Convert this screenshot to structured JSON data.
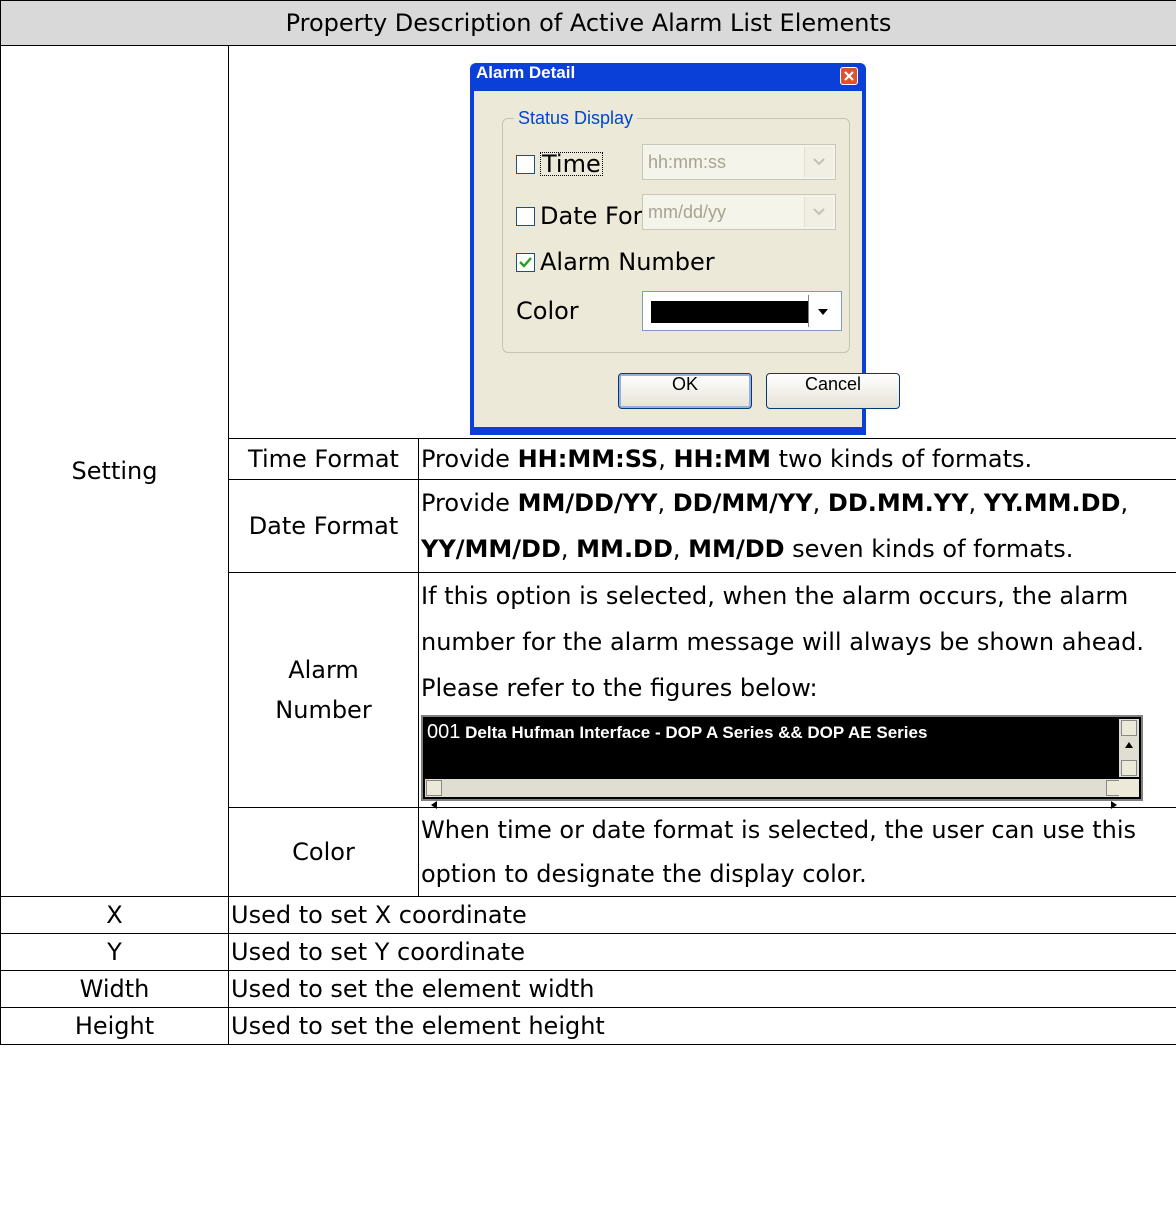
{
  "table": {
    "header": "Property Description of Active Alarm List Elements",
    "setting_label": "Setting",
    "rows": [
      {
        "name": "Time Format",
        "desc_parts": [
          "Provide ",
          "HH:MM:SS",
          ", ",
          "HH:MM",
          " two kinds of formats."
        ]
      },
      {
        "name": "Date Format",
        "desc_parts": [
          "Provide ",
          "MM/DD/YY",
          ", ",
          "DD/MM/YY",
          ", ",
          "DD.MM.YY",
          ", ",
          "YY.MM.DD",
          ", ",
          "YY/MM/DD",
          ", ",
          "MM.DD",
          ", ",
          "MM/DD",
          " seven kinds of formats."
        ]
      },
      {
        "name": "Alarm Number",
        "desc": "If this option is selected, when the alarm occurs, the alarm number for the alarm message will always be shown ahead. Please refer to the figures below:"
      },
      {
        "name": "Color",
        "desc": "When time or date format is selected, the user can use this option to designate the display color."
      }
    ],
    "simple_rows": [
      {
        "name": "X",
        "desc": "Used to set X coordinate"
      },
      {
        "name": "Y",
        "desc": "Used to set Y coordinate"
      },
      {
        "name": "Width",
        "desc": "Used to set the element width"
      },
      {
        "name": "Height",
        "desc": "Used to set the element height"
      }
    ]
  },
  "dialog": {
    "title": "Alarm Detail",
    "group_label": "Status Display",
    "time_label": "Time",
    "time_checked": false,
    "time_value": "hh:mm:ss",
    "date_label": "Date Format",
    "date_checked": false,
    "date_value": "mm/dd/yy",
    "alarm_number_label": "Alarm Number",
    "alarm_number_checked": true,
    "color_label": "Color",
    "color_value": "#000000",
    "ok_label": "OK",
    "cancel_label": "Cancel"
  },
  "preview": {
    "number": "001",
    "message": "Delta Hufman Interface - DOP A Series && DOP AE Series"
  }
}
